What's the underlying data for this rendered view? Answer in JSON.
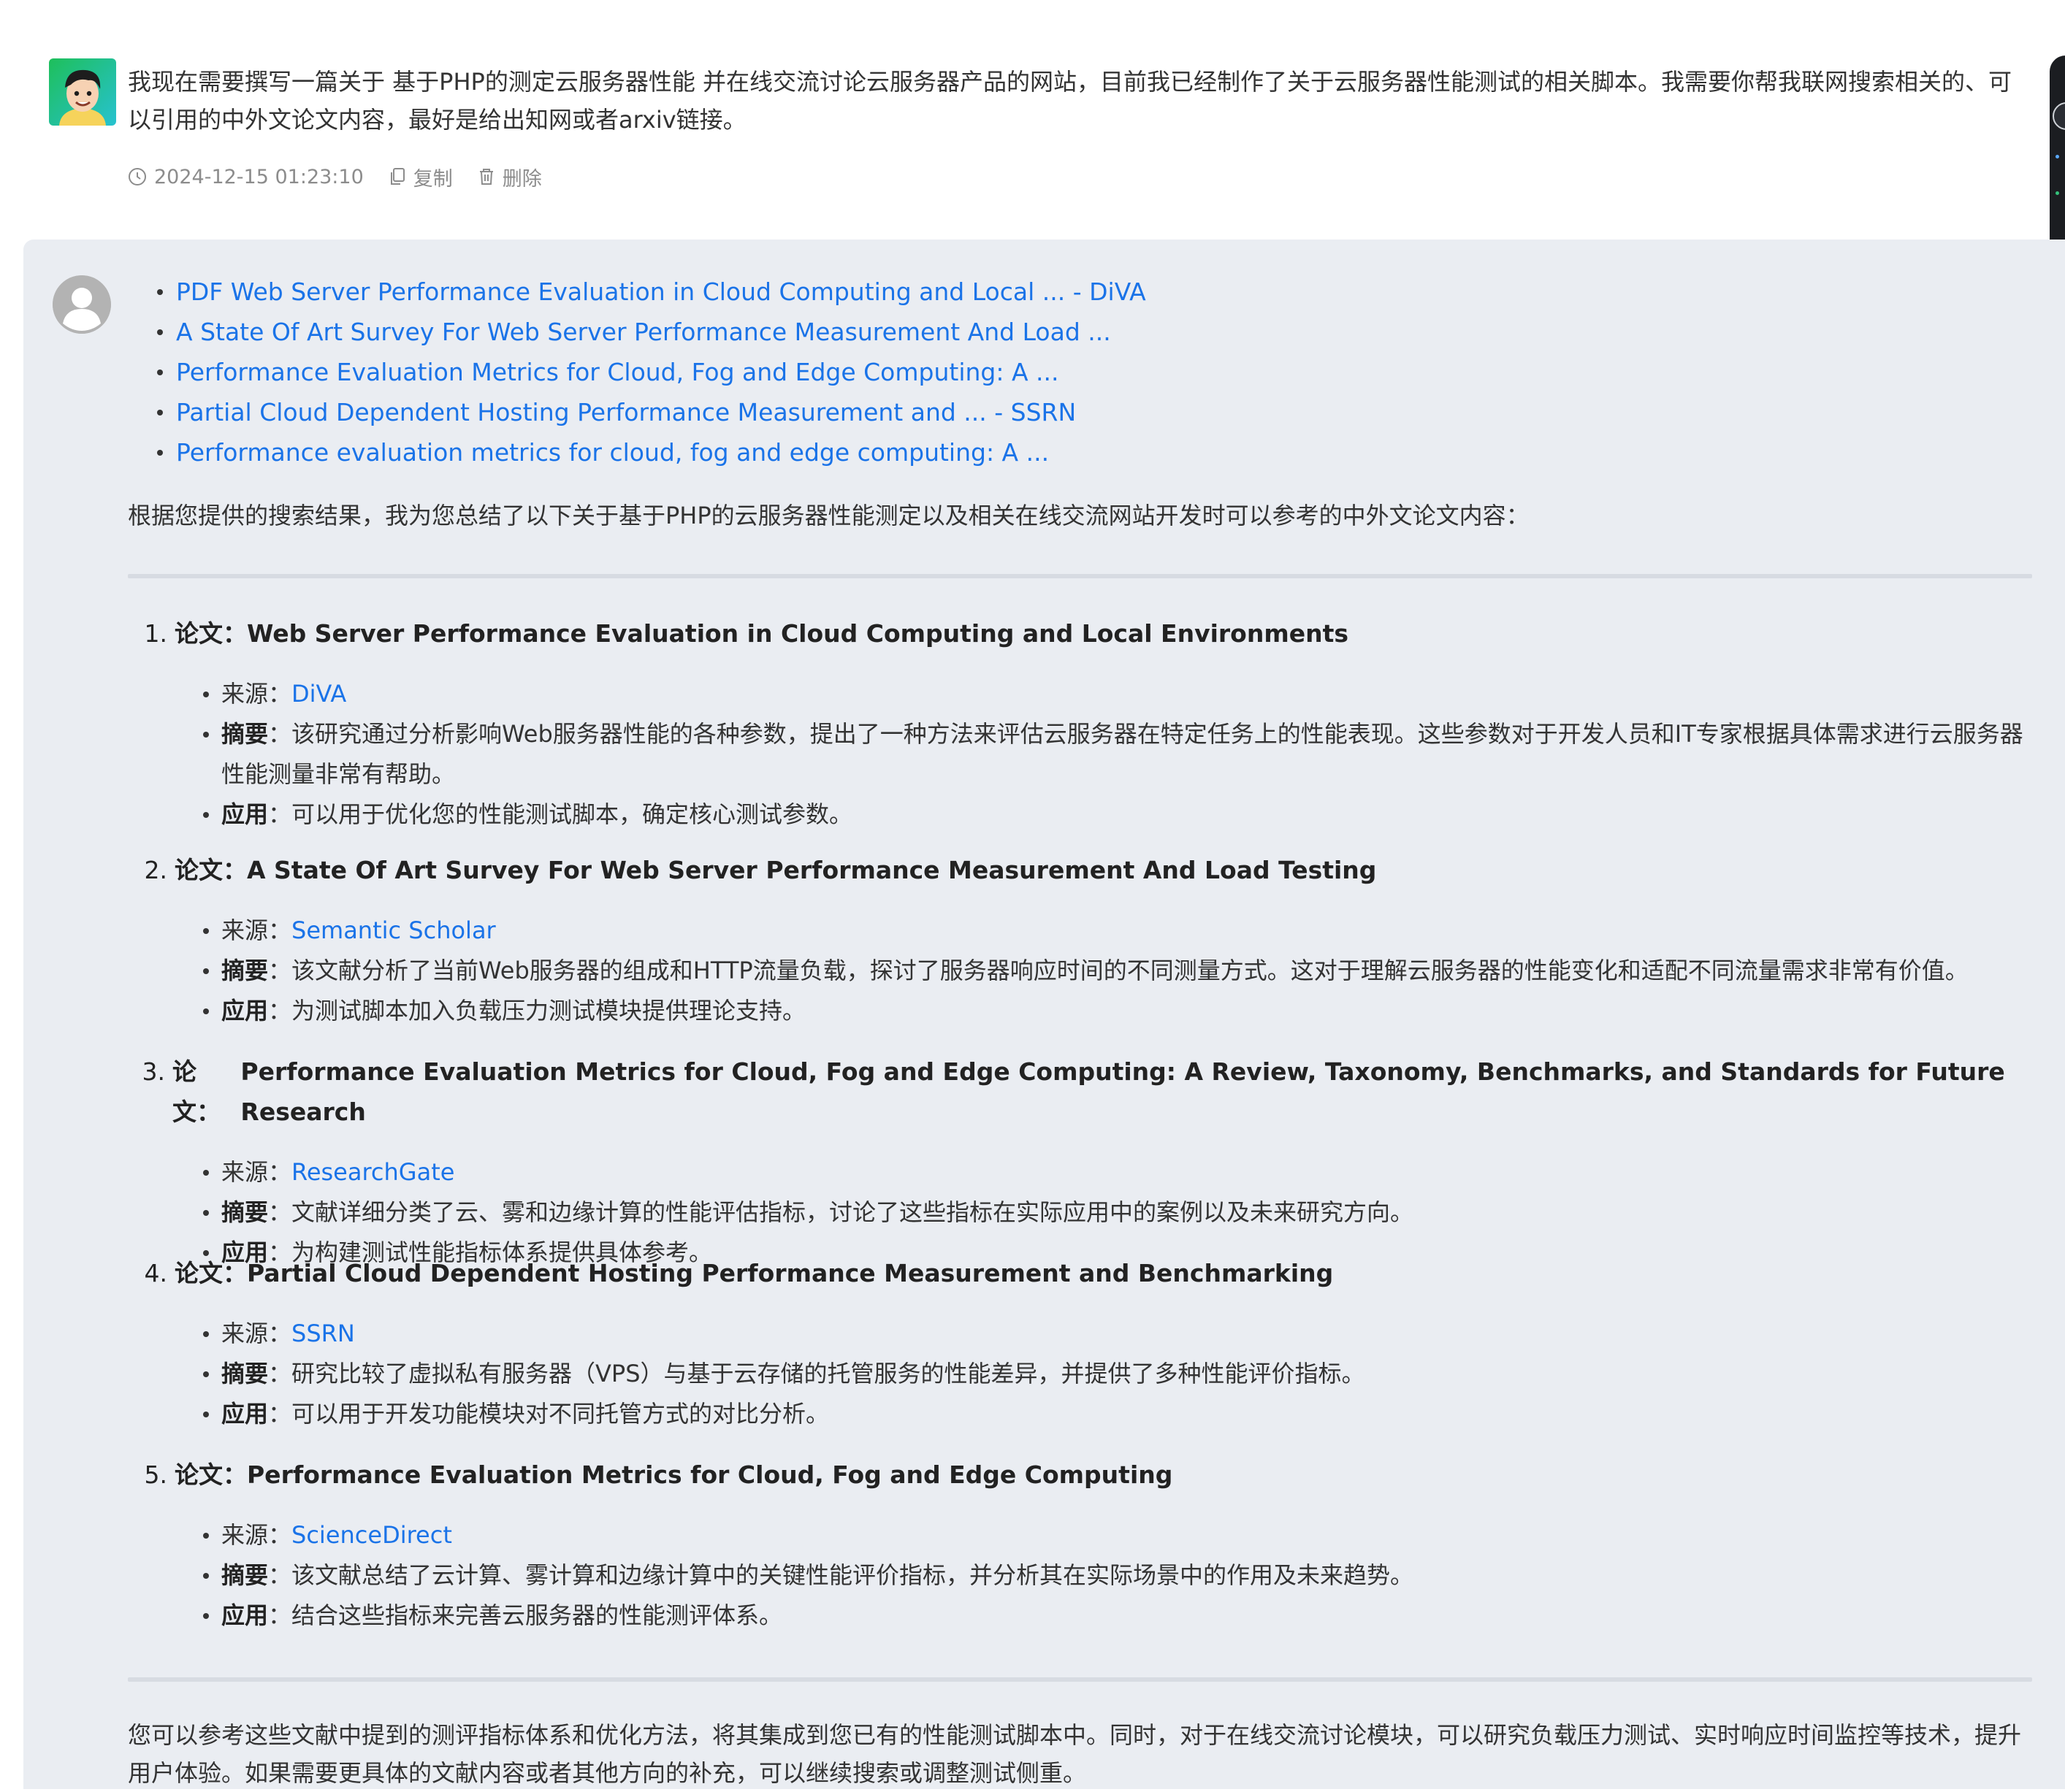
{
  "user_message": {
    "text": "我现在需要撰写一篇关于 基于PHP的测定云服务器性能 并在线交流讨论云服务器产品的网站，目前我已经制作了关于云服务器性能测试的相关脚本。我需要你帮我联网搜索相关的、可以引用的中外文论文内容，最好是给出知网或者arxiv链接。",
    "timestamp": "2024-12-15 01:23:10",
    "copy_label": "复制",
    "delete_label": "删除",
    "icons": {
      "time": "clock-icon",
      "copy": "copy-icon",
      "delete": "trash-icon"
    }
  },
  "assistant_message": {
    "references": [
      "PDF Web Server Performance Evaluation in Cloud Computing and Local ... - DiVA",
      "A State Of Art Survey For Web Server Performance Measurement And Load ...",
      "Performance Evaluation Metrics for Cloud, Fog and Edge Computing: A ...",
      "Partial Cloud Dependent Hosting Performance Measurement and ... - SSRN",
      "Performance evaluation metrics for cloud, fog and edge computing: A ..."
    ],
    "intro": "根据您提供的搜索结果，我为您总结了以下关于基于PHP的云服务器性能测定以及相关在线交流网站开发时可以参考的中外文论文内容：",
    "labels": {
      "paper": "论文：",
      "source": "来源：",
      "abstract": "摘要",
      "application": "应用",
      "colon": "："
    },
    "papers": [
      {
        "num": "1.",
        "title": "Web Server Performance Evaluation in Cloud Computing and Local Environments",
        "source": "DiVA",
        "abstract": "该研究通过分析影响Web服务器性能的各种参数，提出了一种方法来评估云服务器在特定任务上的性能表现。这些参数对于开发人员和IT专家根据具体需求进行云服务器性能测量非常有帮助。",
        "application": "可以用于优化您的性能测试脚本，确定核心测试参数。"
      },
      {
        "num": "2.",
        "title": "A State Of Art Survey For Web Server Performance Measurement And Load Testing",
        "source": "Semantic Scholar",
        "abstract": "该文献分析了当前Web服务器的组成和HTTP流量负载，探讨了服务器响应时间的不同测量方式。这对于理解云服务器的性能变化和适配不同流量需求非常有价值。",
        "application": "为测试脚本加入负载压力测试模块提供理论支持。"
      },
      {
        "num": "3.",
        "title": "Performance Evaluation Metrics for Cloud, Fog and Edge Computing: A Review, Taxonomy, Benchmarks, and Standards for Future Research",
        "source": "ResearchGate",
        "abstract": "文献详细分类了云、雾和边缘计算的性能评估指标，讨论了这些指标在实际应用中的案例以及未来研究方向。",
        "application": "为构建测试性能指标体系提供具体参考。"
      },
      {
        "num": "4.",
        "title": "Partial Cloud Dependent Hosting Performance Measurement and Benchmarking",
        "source": "SSRN",
        "abstract": "研究比较了虚拟私有服务器（VPS）与基于云存储的托管服务的性能差异，并提供了多种性能评价指标。",
        "application": "可以用于开发功能模块对不同托管方式的对比分析。"
      },
      {
        "num": "5.",
        "title": "Performance Evaluation Metrics for Cloud, Fog and Edge Computing",
        "source": "ScienceDirect",
        "abstract": "该文献总结了云计算、雾计算和边缘计算中的关键性能评价指标，并分析其在实际场景中的作用及未来趋势。",
        "application": "结合这些指标来完善云服务器的性能测评体系。"
      }
    ],
    "closing": "您可以参考这些文献中提到的测评指标体系和优化方法，将其集成到您已有的性能测试脚本中。同时，对于在线交流讨论模块，可以研究负载压力测试、实时响应时间监控等技术，提升用户体验。如果需要更具体的文献内容或者其他方向的补充，可以继续搜索或调整测试侧重。"
  },
  "colors": {
    "link": "#1a73e8",
    "assistant_background": "#eaedf2",
    "text": "#333333",
    "meta": "#8c8c8c"
  }
}
